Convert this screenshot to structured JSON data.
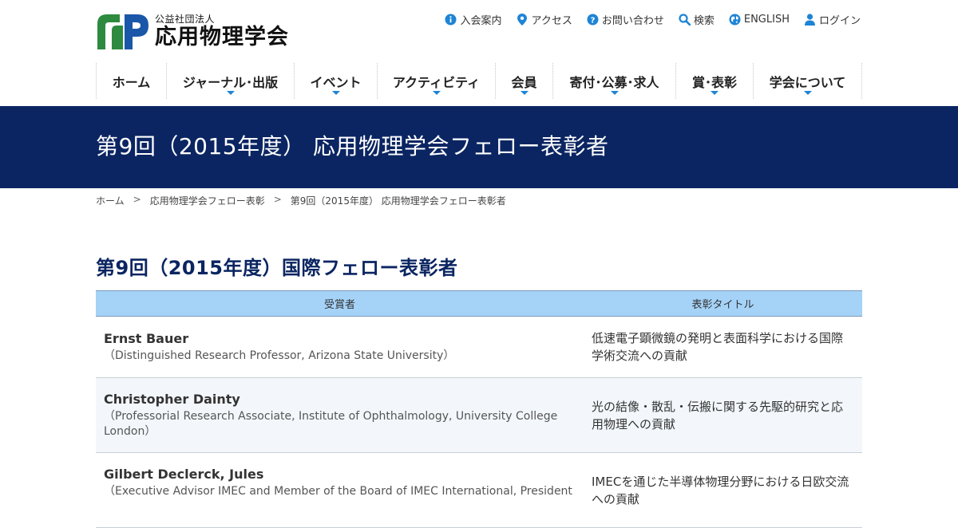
{
  "header": {
    "logo": {
      "sub": "公益社団法人",
      "main": "応用物理学会"
    },
    "utility": [
      {
        "label": "入会案内",
        "icon": "info-icon"
      },
      {
        "label": "アクセス",
        "icon": "map-pin-icon"
      },
      {
        "label": "お問い合わせ",
        "icon": "question-icon"
      },
      {
        "label": "検索",
        "icon": "search-icon"
      },
      {
        "label": "ENGLISH",
        "icon": "globe-icon"
      },
      {
        "label": "ログイン",
        "icon": "user-icon"
      }
    ],
    "nav": [
      {
        "label": "ホーム",
        "dropdown": false
      },
      {
        "label": "ジャーナル･出版",
        "dropdown": true
      },
      {
        "label": "イベント",
        "dropdown": true
      },
      {
        "label": "アクティビティ",
        "dropdown": true
      },
      {
        "label": "会員",
        "dropdown": true
      },
      {
        "label": "寄付･公募･求人",
        "dropdown": true
      },
      {
        "label": "賞･表彰",
        "dropdown": true
      },
      {
        "label": "学会について",
        "dropdown": true
      }
    ]
  },
  "hero": {
    "title": "第9回（2015年度） 応用物理学会フェロー表彰者"
  },
  "breadcrumb": [
    "ホーム",
    "応用物理学会フェロー表彰",
    "第9回（2015年度） 応用物理学会フェロー表彰者"
  ],
  "breadcrumb_sep": ">",
  "section": {
    "title": "第9回（2015年度）国際フェロー表彰者"
  },
  "table": {
    "headers": [
      "受賞者",
      "表彰タイトル"
    ],
    "rows": [
      {
        "name": "Ernst Bauer",
        "affiliation": "（Distinguished Research Professor, Arizona State University）",
        "award": "低速電子顕微鏡の発明と表面科学における国際学術交流への貢献"
      },
      {
        "name": "Christopher Dainty",
        "affiliation": "（Professorial Research Associate, Institute of Ophthalmology, University College London）",
        "award": "光の結像・散乱・伝搬に関する先駆的研究と応用物理への貢献"
      },
      {
        "name": "Gilbert Declerck, Jules",
        "affiliation": "（Executive Advisor IMEC and Member of the Board of IMEC International, President",
        "award": "IMECを通じた半導体物理分野における日欧交流への貢献"
      }
    ]
  },
  "colors": {
    "navy": "#0b2562",
    "header_blue": "#a5d3f8",
    "accent": "#1d84d6",
    "logo_green": "#2d8a3e"
  }
}
